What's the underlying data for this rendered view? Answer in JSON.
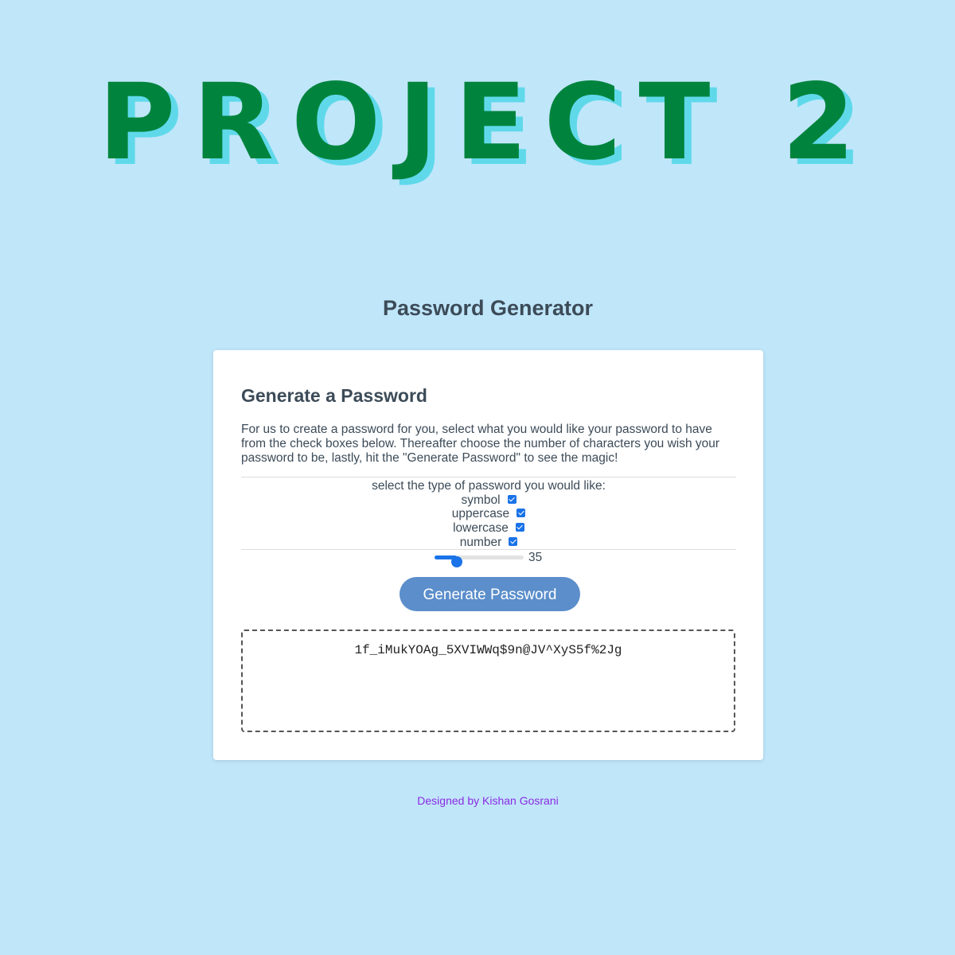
{
  "logo": {
    "text": "PROJECT 2"
  },
  "page": {
    "subtitle": "Password Generator"
  },
  "card": {
    "title": "Generate a Password",
    "description": "For us to create a password for you, select what you would like your password to have from the check boxes below. Thereafter choose the number of characters you wish your password to be, lastly, hit the \"Generate Password\" to see the magic!",
    "options_prompt": "select the type of password you would like:",
    "options": [
      {
        "label": "symbol",
        "checked": true
      },
      {
        "label": "uppercase",
        "checked": true
      },
      {
        "label": "lowercase",
        "checked": true
      },
      {
        "label": "number",
        "checked": true
      }
    ],
    "slider": {
      "value": "35",
      "fill_fraction": 0.25
    },
    "button_label": "Generate Password",
    "output": "1f_iMukYOAg_5XVIWWq$9n@JV^XyS5f%2Jg"
  },
  "footer": {
    "text": "Designed by Kishan Gosrani"
  },
  "colors": {
    "background": "#c0e6fa",
    "logo": "#00843d",
    "logo_shadow": "#5fd9ea",
    "accent": "#1a73e8",
    "button": "#5b8ecb",
    "footer": "#8a2be2"
  }
}
